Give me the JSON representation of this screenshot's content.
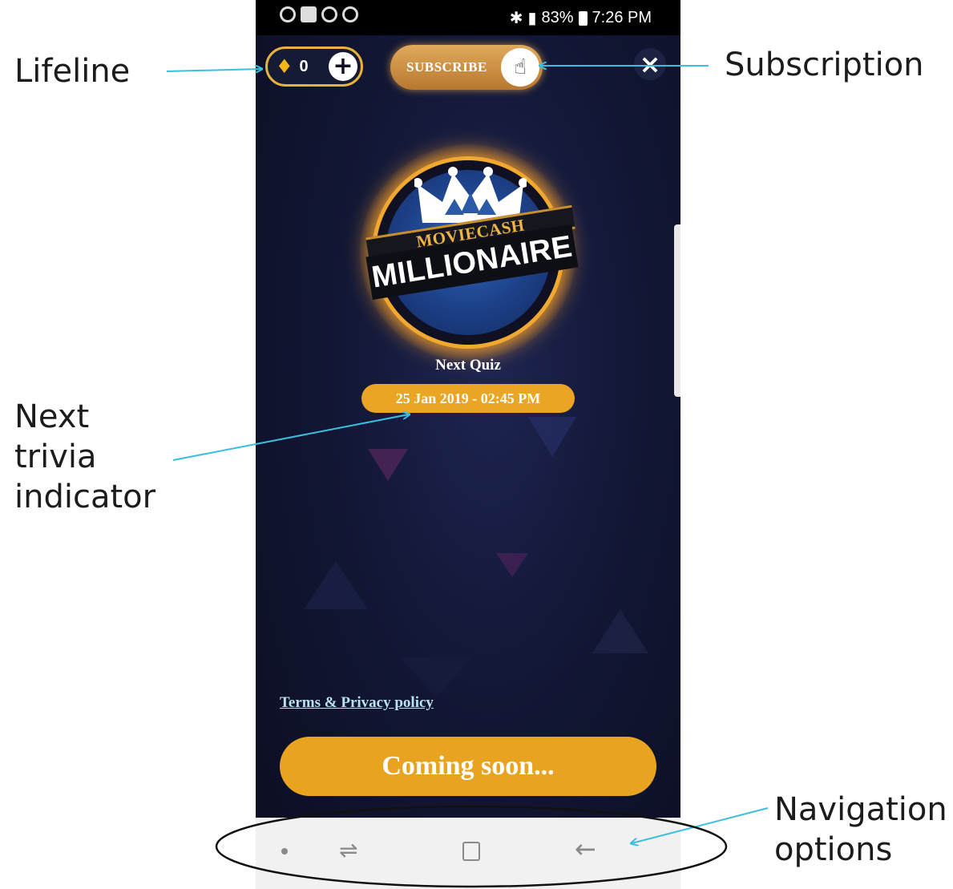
{
  "callouts": {
    "lifeline": "Lifeline",
    "subscription": "Subscription",
    "next_trivia": "Next\ntrivia\nindicator",
    "navigation": "Navigation\noptions"
  },
  "status_bar": {
    "battery": "83%",
    "time": "7:26 PM"
  },
  "lifeline": {
    "count": "0",
    "icon": "gem-icon"
  },
  "subscribe": {
    "label": "SUBSCRIBE",
    "icon": "hand-pointer-icon"
  },
  "logo": {
    "top_text": "MOVIECASH",
    "main_text": "MILLIONAIRE"
  },
  "next_quiz": {
    "label": "Next Quiz",
    "datetime": "25 Jan 2019 - 02:45 PM"
  },
  "terms_link": "Terms & Privacy policy",
  "main_button": "Coming soon...",
  "colors": {
    "accent": "#e8a320",
    "background": "#121735",
    "link": "#b8e2ef",
    "arrow": "#3bbfe0"
  }
}
